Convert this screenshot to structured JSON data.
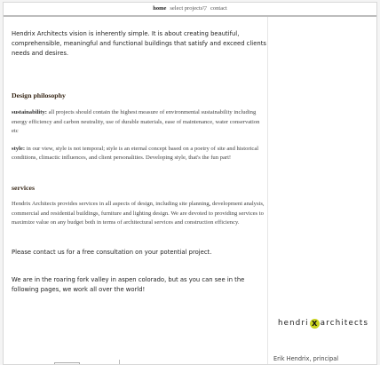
{
  "nav": {
    "items": [
      {
        "label": "home",
        "current": true
      },
      {
        "label": "select projects",
        "current": false
      },
      {
        "label": "contact",
        "current": false
      }
    ]
  },
  "intro": "Hendrix Architects vision is inherently simple.  It is about creating beautiful, comprehensible, meaningful and functional buildings that satisfy and exceed clients needs and desires.",
  "philosophy": {
    "heading": "Design philosophy",
    "sustainability_term": "sustainability:",
    "sustainability_text": " all projects should contain the highest measure of environmental sustainability including energy efficiency and carbon neutrality, use of durable materials, ease of maintenance, water conservation etc",
    "style_term": "style:",
    "style_text": " in our view, style is not temporal; style is an eternal concept based on a poetry of site and historical conditions, climactic influences, and client personalities.  Developing style, that's the fun part!"
  },
  "services": {
    "heading": "services",
    "text": "Hendrix Architects provides services in all aspects of design, including site planning, development analysis, commercial and residential buildings, furniture and lighting design.  We are devoted to providing services to maximize value on any budget both in terms of architectural services and construction efficiency."
  },
  "contact_line": "Please contact us for a free consultation on your potential project.",
  "location_line": "We are in the roaring fork valley in aspen colorado, but as you can see in the following pages, we work all over the world!",
  "sidebar": {
    "logo_left": "hendri",
    "logo_mark": "X",
    "logo_right": "architects",
    "principal": "Erik Hendrix, principal"
  },
  "colors": {
    "logo_mark_bg": "#c8d21f"
  }
}
